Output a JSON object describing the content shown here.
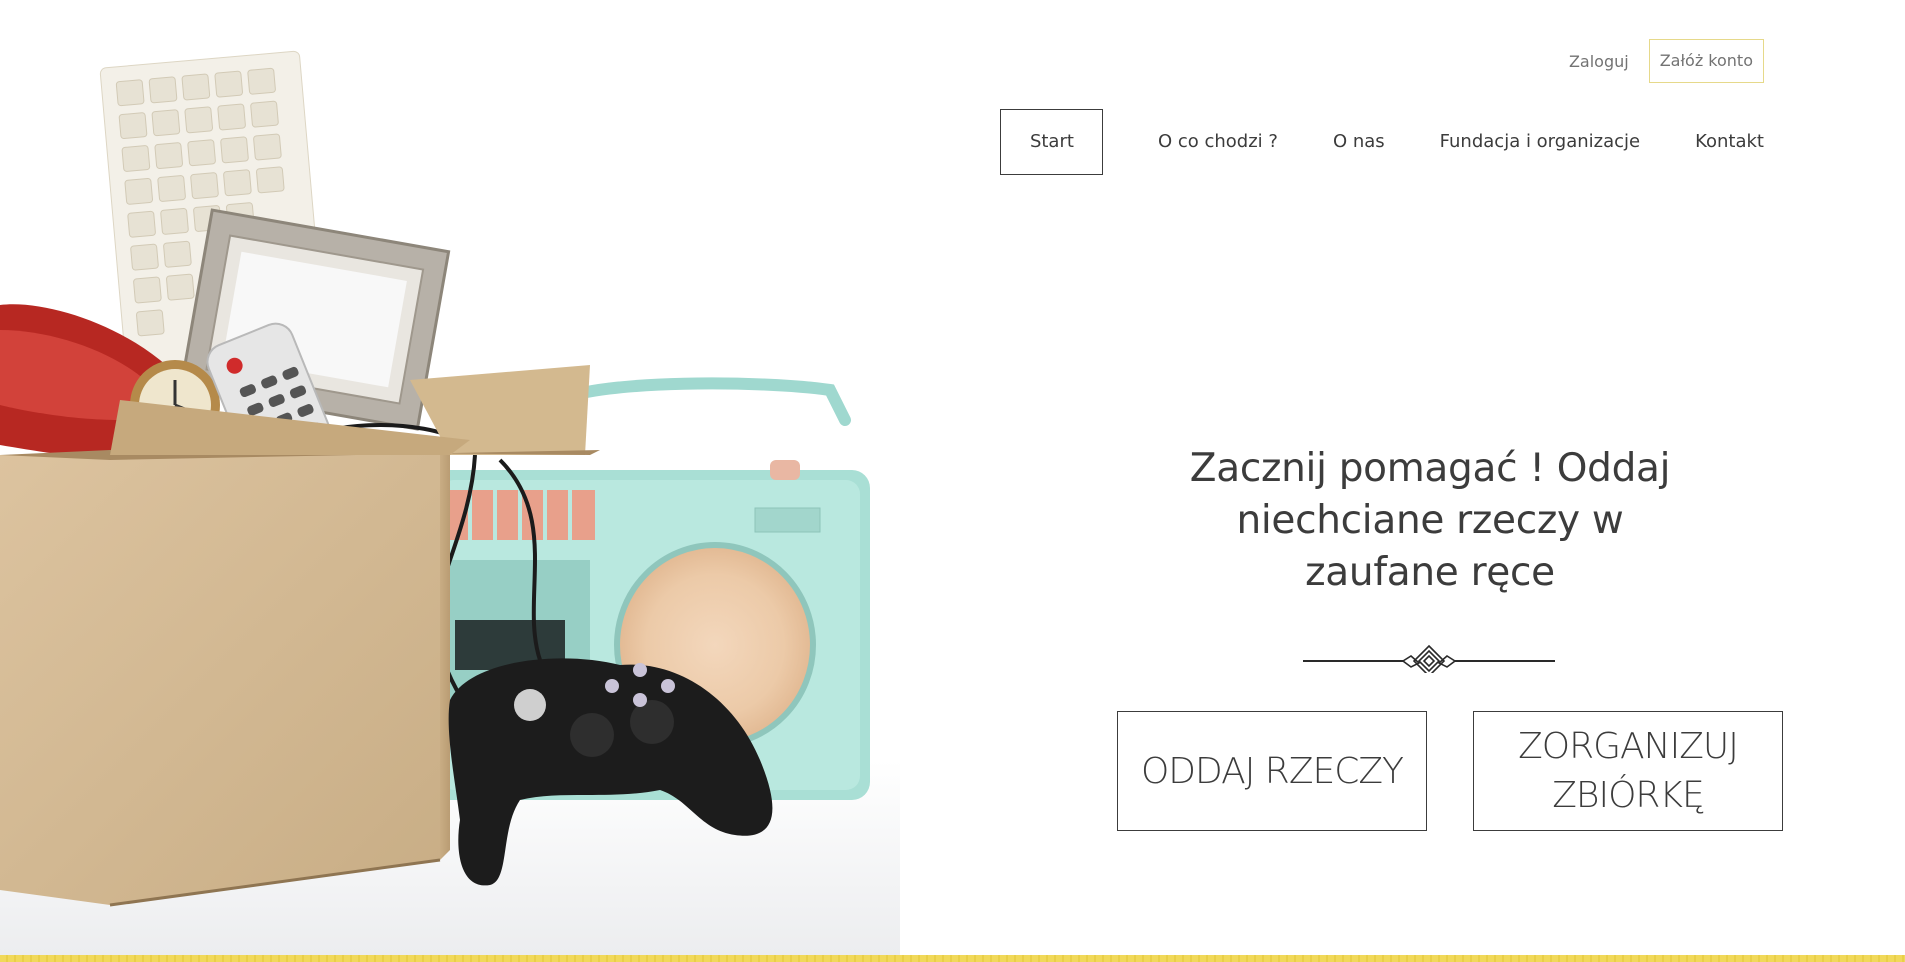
{
  "header": {
    "login_label": "Zaloguj",
    "register_label": "Załóż konto"
  },
  "nav": {
    "items": [
      {
        "label": "Start",
        "active": true
      },
      {
        "label": "O co chodzi ?",
        "active": false
      },
      {
        "label": "O nas",
        "active": false
      },
      {
        "label": "Fundacja i organizacje",
        "active": false
      },
      {
        "label": "Kontakt",
        "active": false
      }
    ]
  },
  "hero": {
    "title": "Zacznij pomagać ! Oddaj niechciane rzeczy w zaufane ręce",
    "give_button_label": "ODDAJ RZECZY",
    "organize_button_label": "ZORGANIZUJ ZBIÓRKĘ",
    "image_subject": "cardboard-box-with-unwanted-items"
  },
  "colors": {
    "text": "#3c3c3c",
    "muted_text": "#737373",
    "accent": "#f1d95a",
    "register_border": "#e6d98a"
  }
}
